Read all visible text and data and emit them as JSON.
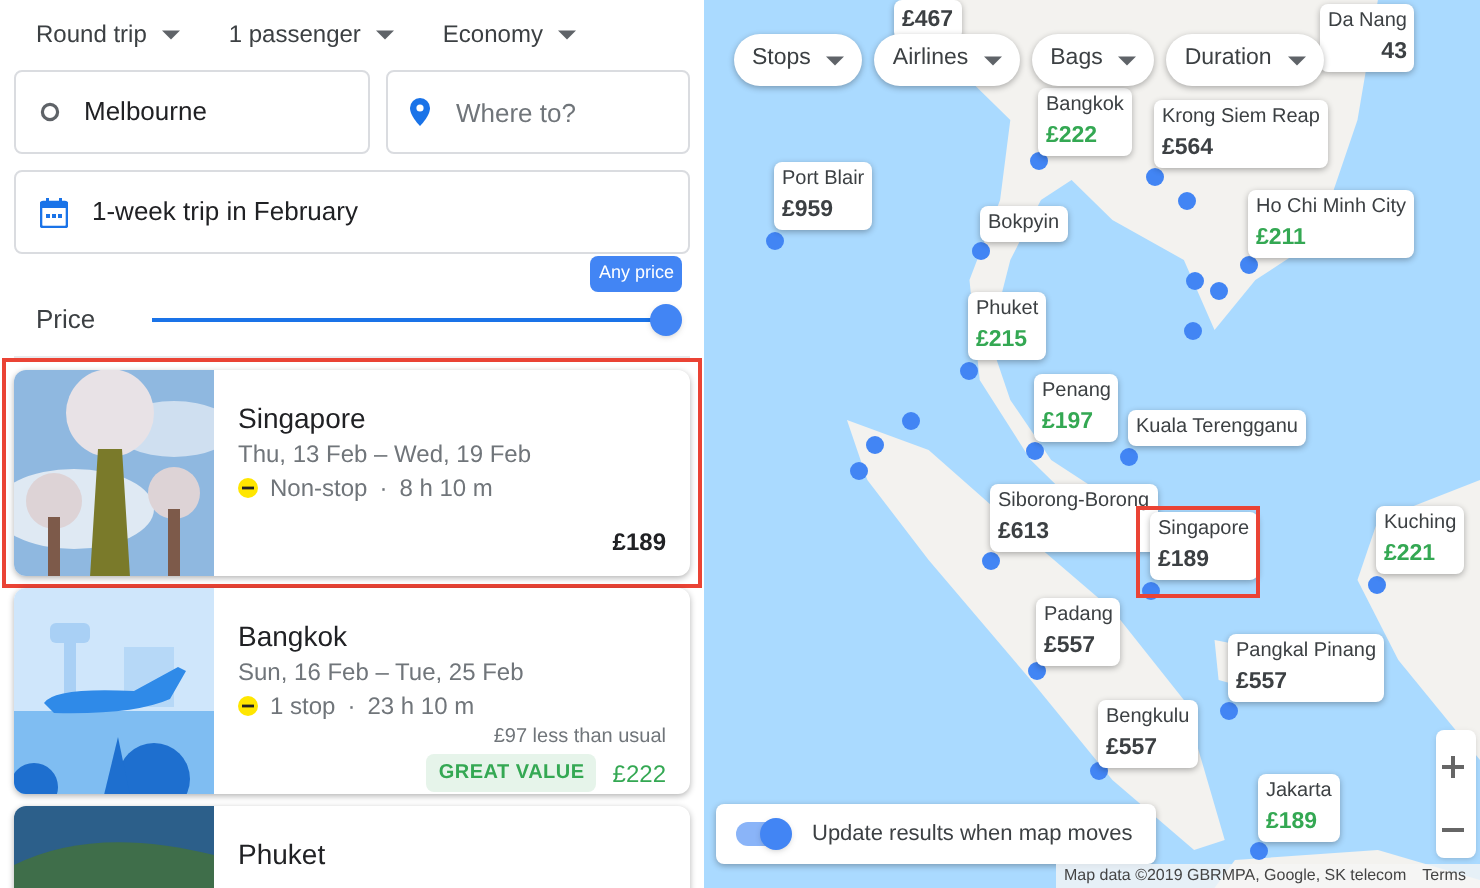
{
  "trip_options": [
    {
      "label": "Round trip"
    },
    {
      "label": "1 passenger"
    },
    {
      "label": "Economy"
    }
  ],
  "origin": {
    "value": "Melbourne"
  },
  "destination": {
    "placeholder": "Where to?"
  },
  "dates": {
    "value": "1-week trip in February"
  },
  "price_filter": {
    "label": "Price",
    "tooltip": "Any price",
    "level": 1
  },
  "results": [
    {
      "city": "Singapore",
      "dates": "Thu, 13 Feb – Wed, 19 Feb",
      "stops": "Non-stop",
      "separator": "·",
      "duration": "8 h 10 m",
      "price": "£189",
      "good_price": false,
      "selected": true
    },
    {
      "city": "Bangkok",
      "dates": "Sun, 16 Feb – Tue, 25 Feb",
      "stops": "1 stop",
      "separator": "·",
      "duration": "23 h 10 m",
      "note": "£97 less than usual",
      "badge": "GREAT VALUE",
      "price": "£222",
      "good_price": true,
      "selected": false
    },
    {
      "city": "Phuket",
      "selected": false
    }
  ],
  "map_filters": [
    {
      "label": "Stops"
    },
    {
      "label": "Airlines"
    },
    {
      "label": "Bags"
    },
    {
      "label": "Duration"
    }
  ],
  "map_labels": [
    {
      "price": "£467",
      "good_price": false
    },
    {
      "name": "Da Nang",
      "price": "43",
      "good_price": false
    },
    {
      "name": "Bangkok",
      "price": "£222",
      "good_price": true
    },
    {
      "name": "Krong Siem Reap",
      "price": "£564",
      "good_price": false
    },
    {
      "name": "Port Blair",
      "price": "£959",
      "good_price": false
    },
    {
      "name": "Bokpyin"
    },
    {
      "name": "Ho Chi Minh City",
      "price": "£211",
      "good_price": true
    },
    {
      "name": "Phuket",
      "price": "£215",
      "good_price": true
    },
    {
      "name": "Penang",
      "price": "£197",
      "good_price": true
    },
    {
      "name": "Kuala Terengganu"
    },
    {
      "name": "Siborong-Borong",
      "price": "£613",
      "good_price": false
    },
    {
      "name": "Singapore",
      "price": "£189",
      "good_price": false,
      "selected": true
    },
    {
      "name": "Kuching",
      "price": "£221",
      "good_price": true
    },
    {
      "name": "Padang",
      "price": "£557",
      "good_price": false
    },
    {
      "name": "Pangkal Pinang",
      "price": "£557",
      "good_price": false
    },
    {
      "name": "Bengkulu",
      "price": "£557",
      "good_price": false
    },
    {
      "name": "Jakarta",
      "price": "£189",
      "good_price": true
    }
  ],
  "map_toggle": {
    "label": "Update results when map moves",
    "on": true
  },
  "map_footer": {
    "attribution": "Map data ©2019 GBRMPA, Google, SK telecom",
    "terms": "Terms"
  }
}
